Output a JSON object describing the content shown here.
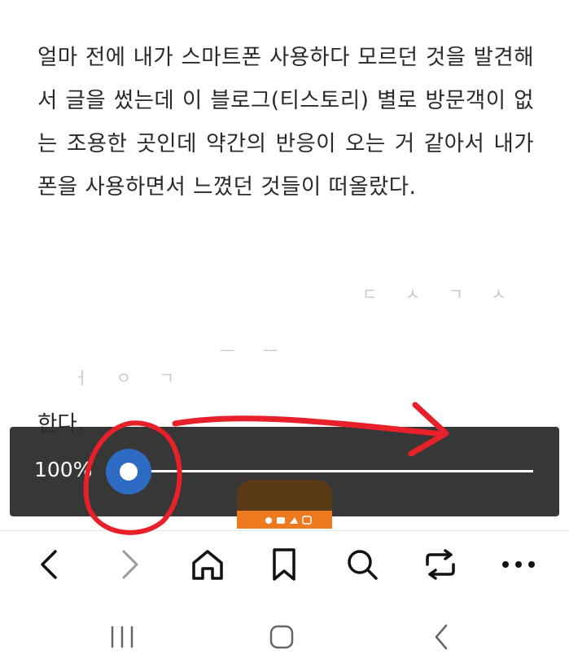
{
  "article": {
    "paragraph": "얼마 전에 내가 스마트폰 사용하다 모르던 것을 발견해서 글을 썼는데 이 블로그(티스토리) 별로 방문객이 없는 조용한 곳인데 약간의 반응이 오는 거 같아서 내가 폰을 사용하면서 느꼈던 것들이 떠올랐다.",
    "peek_text": "한다."
  },
  "zoom": {
    "label": "100%",
    "value_percent": 100
  },
  "toolbar": {
    "items": [
      "back",
      "forward",
      "home",
      "bookmarks",
      "search",
      "tabs-sync",
      "more"
    ]
  },
  "system_nav": {
    "items": [
      "recent-apps",
      "home",
      "back"
    ]
  },
  "colors": {
    "panel": "#282828",
    "thumb": "#2e6cc4",
    "annotation": "#e8202a",
    "ad_accent": "#ee7a1f"
  }
}
